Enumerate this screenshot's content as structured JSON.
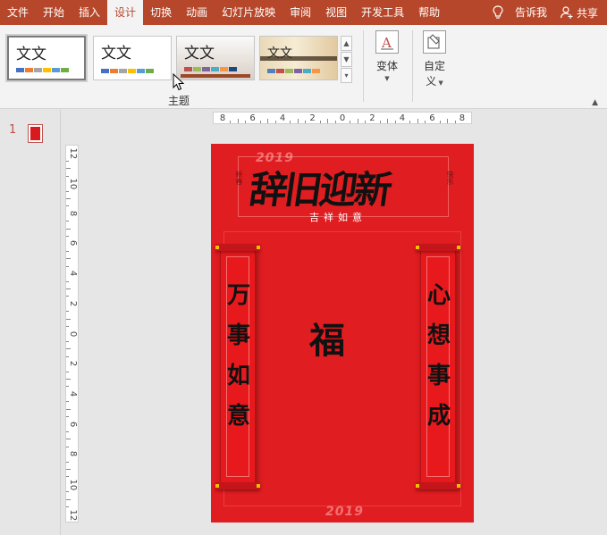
{
  "menu": {
    "items": [
      "文件",
      "开始",
      "插入",
      "设计",
      "切换",
      "动画",
      "幻灯片放映",
      "审阅",
      "视图",
      "开发工具",
      "帮助"
    ],
    "active_index": 3,
    "tell_me": "告诉我",
    "share": "共享"
  },
  "ribbon": {
    "themes": [
      {
        "sample": "文文",
        "swatches": [
          "#4472c4",
          "#ed7d31",
          "#a5a5a5",
          "#ffc000",
          "#5b9bd5",
          "#70ad47"
        ]
      },
      {
        "sample": "文文",
        "swatches": [
          "#4472c4",
          "#ed7d31",
          "#a5a5a5",
          "#ffc000",
          "#5b9bd5",
          "#70ad47"
        ]
      },
      {
        "sample": "文文",
        "swatches": [
          "#c0504d",
          "#9bbb59",
          "#8064a2",
          "#4bacc6",
          "#f79646",
          "#1f497d"
        ]
      },
      {
        "sample": "文文",
        "swatches": [
          "#4f81bd",
          "#c0504d",
          "#9bbb59",
          "#8064a2",
          "#4bacc6",
          "#f79646"
        ]
      }
    ],
    "group_label": "主题",
    "variants_label": "变体",
    "customize_label_1": "自定",
    "customize_label_2": "义"
  },
  "slides_pane": {
    "slide_number": "1"
  },
  "ruler": {
    "h_labels": [
      "8",
      "6",
      "4",
      "2",
      "0",
      "2",
      "4",
      "6",
      "8"
    ],
    "v_labels": [
      "12",
      "10",
      "8",
      "6",
      "4",
      "2",
      "0",
      "2",
      "4",
      "6",
      "8",
      "10",
      "12"
    ]
  },
  "slide": {
    "year_top": "2019",
    "year_bottom": "2019",
    "title": "辞旧迎新",
    "side_left": "新春",
    "side_right": "快乐",
    "subtitle": "吉祥如意",
    "couplet_left": "万事如意",
    "couplet_right": "心想事成",
    "center": "福",
    "background_color": "#e01d20"
  }
}
